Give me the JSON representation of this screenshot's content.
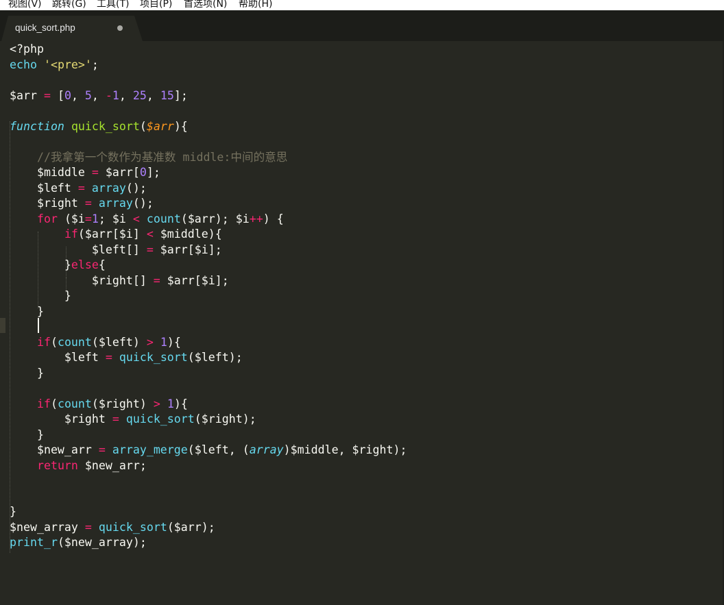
{
  "menu": [
    "视图(V)",
    "跳转(G)",
    "工具(T)",
    "项目(P)",
    "首选项(N)",
    "帮助(H)"
  ],
  "tab": {
    "title": "quick_sort.php",
    "unsaved": true
  },
  "code": {
    "comment": "//我拿第一个数作为基准数 middle:中间的意思"
  },
  "colors": {
    "background": "#272822",
    "keyword": "#f92672",
    "function": "#66d9ef",
    "string": "#e6db74",
    "number": "#ae81ff",
    "parameter": "#fd971f",
    "definition": "#a6e22e",
    "comment": "#75715e"
  }
}
